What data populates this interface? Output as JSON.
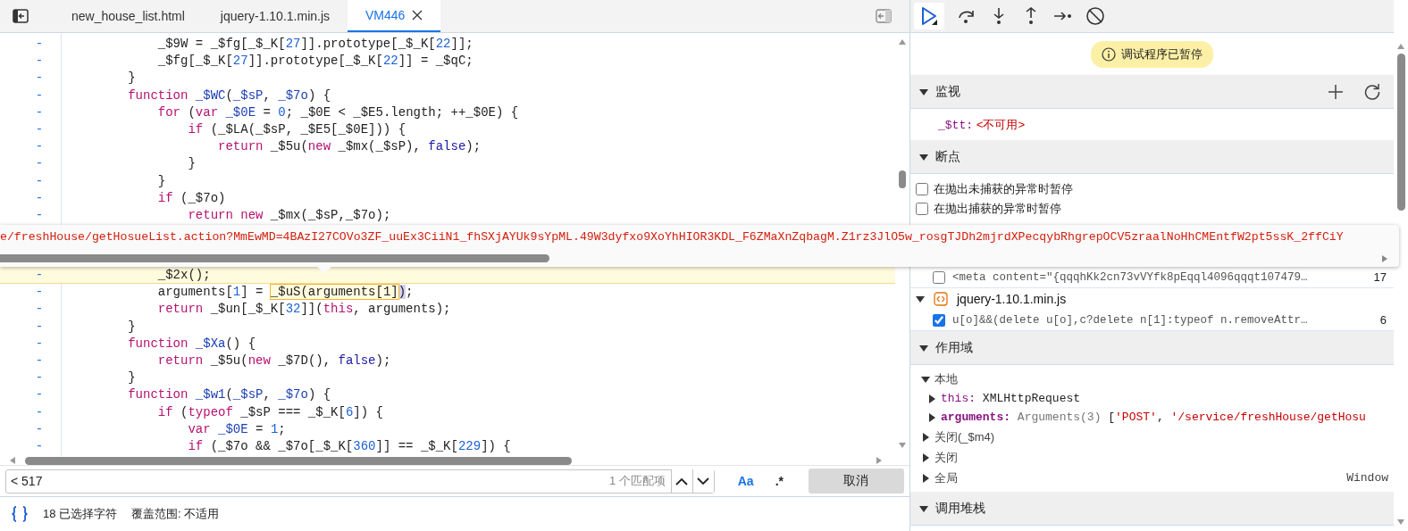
{
  "tabs": [
    {
      "label": "new_house_list.html",
      "selected": false,
      "closable": false
    },
    {
      "label": "jquery-1.10.1.min.js",
      "selected": false,
      "closable": false
    },
    {
      "label": "VM446",
      "selected": true,
      "closable": true
    }
  ],
  "code": {
    "blocks": [
      {
        "lines": [
          {
            "gutter": "-",
            "highlighted": false,
            "tokens": [
              {
                "t": "            _$9W = _$fg[_$_K[",
                "kind": "plain"
              },
              {
                "t": "27",
                "kind": "num"
              },
              {
                "t": "]].prototype[_$_K[",
                "kind": "plain"
              },
              {
                "t": "22",
                "kind": "num"
              },
              {
                "t": "]];",
                "kind": "plain"
              }
            ]
          },
          {
            "gutter": "-",
            "highlighted": false,
            "tokens": [
              {
                "t": "            _$fg[_$_K[",
                "kind": "plain"
              },
              {
                "t": "27",
                "kind": "num"
              },
              {
                "t": "]].prototype[_$_K[",
                "kind": "plain"
              },
              {
                "t": "22",
                "kind": "num"
              },
              {
                "t": "]] = _$qC;",
                "kind": "plain"
              }
            ]
          },
          {
            "gutter": "-",
            "highlighted": false,
            "tokens": [
              {
                "t": "        }",
                "kind": "plain"
              }
            ]
          },
          {
            "gutter": "-",
            "highlighted": false,
            "tokens": [
              {
                "t": "        function",
                "kind": "kw"
              },
              {
                "t": " _$WC",
                "kind": "def"
              },
              {
                "t": "(",
                "kind": "plain"
              },
              {
                "t": "_$sP",
                "kind": "def"
              },
              {
                "t": ", ",
                "kind": "plain"
              },
              {
                "t": "_$7o",
                "kind": "def"
              },
              {
                "t": ") {",
                "kind": "plain"
              }
            ]
          },
          {
            "gutter": "-",
            "highlighted": false,
            "tokens": [
              {
                "t": "            for",
                "kind": "kw"
              },
              {
                "t": " (",
                "kind": "plain"
              },
              {
                "t": "var",
                "kind": "kw"
              },
              {
                "t": " _$0E",
                "kind": "def"
              },
              {
                "t": " = ",
                "kind": "plain"
              },
              {
                "t": "0",
                "kind": "num"
              },
              {
                "t": "; _$0E < _$E5.length; ++_$0E) {",
                "kind": "plain"
              }
            ]
          },
          {
            "gutter": "-",
            "highlighted": false,
            "tokens": [
              {
                "t": "                if",
                "kind": "kw"
              },
              {
                "t": " (_$LA(_$sP, _$E5[_$0E])) {",
                "kind": "plain"
              }
            ]
          },
          {
            "gutter": "-",
            "highlighted": false,
            "tokens": [
              {
                "t": "                    return",
                "kind": "kw"
              },
              {
                "t": " _$5u(",
                "kind": "plain"
              },
              {
                "t": "new",
                "kind": "kw"
              },
              {
                "t": " _$mx(_$sP), ",
                "kind": "plain"
              },
              {
                "t": "false",
                "kind": "atom"
              },
              {
                "t": ");",
                "kind": "plain"
              }
            ]
          },
          {
            "gutter": "-",
            "highlighted": false,
            "tokens": [
              {
                "t": "                }",
                "kind": "plain"
              }
            ]
          },
          {
            "gutter": "-",
            "highlighted": false,
            "tokens": [
              {
                "t": "            }",
                "kind": "plain"
              }
            ]
          },
          {
            "gutter": "-",
            "highlighted": false,
            "tokens": [
              {
                "t": "            if",
                "kind": "kw"
              },
              {
                "t": " (_$7o)",
                "kind": "plain"
              }
            ]
          },
          {
            "gutter": "-",
            "highlighted": false,
            "tokens": [
              {
                "t": "                return",
                "kind": "kw"
              },
              {
                "t": " new",
                "kind": "kw"
              },
              {
                "t": " _$mx(_$sP,_$7o);",
                "kind": "plain"
              }
            ]
          }
        ]
      },
      {
        "lines": [
          {
            "gutter": "-",
            "highlighted": true,
            "tokens": [
              {
                "t": "            _$2x();",
                "kind": "plain"
              }
            ]
          },
          {
            "gutter": "-",
            "highlighted": false,
            "tokens": [
              {
                "t": "            arguments[",
                "kind": "plain"
              },
              {
                "t": "1",
                "kind": "num"
              },
              {
                "t": "] = ",
                "kind": "plain"
              },
              {
                "t": "_$uS(arguments[1]",
                "kind": "match"
              },
              {
                "t": ")",
                "kind": "bracket"
              },
              {
                "t": ";",
                "kind": "plain"
              }
            ]
          },
          {
            "gutter": "-",
            "highlighted": false,
            "tokens": [
              {
                "t": "            return",
                "kind": "kw"
              },
              {
                "t": " _$un[_$_K[",
                "kind": "plain"
              },
              {
                "t": "32",
                "kind": "num"
              },
              {
                "t": "]](",
                "kind": "plain"
              },
              {
                "t": "this",
                "kind": "kw"
              },
              {
                "t": ", arguments);",
                "kind": "plain"
              }
            ]
          },
          {
            "gutter": "-",
            "highlighted": false,
            "tokens": [
              {
                "t": "        }",
                "kind": "plain"
              }
            ]
          },
          {
            "gutter": "-",
            "highlighted": false,
            "tokens": [
              {
                "t": "        function",
                "kind": "kw"
              },
              {
                "t": " _$Xa",
                "kind": "def"
              },
              {
                "t": "() {",
                "kind": "plain"
              }
            ]
          },
          {
            "gutter": "-",
            "highlighted": false,
            "tokens": [
              {
                "t": "            return",
                "kind": "kw"
              },
              {
                "t": " _$5u(",
                "kind": "plain"
              },
              {
                "t": "new",
                "kind": "kw"
              },
              {
                "t": " _$7D(), ",
                "kind": "plain"
              },
              {
                "t": "false",
                "kind": "atom"
              },
              {
                "t": ");",
                "kind": "plain"
              }
            ]
          },
          {
            "gutter": "-",
            "highlighted": false,
            "tokens": [
              {
                "t": "        }",
                "kind": "plain"
              }
            ]
          },
          {
            "gutter": "-",
            "highlighted": false,
            "tokens": [
              {
                "t": "        function",
                "kind": "kw"
              },
              {
                "t": " _$w1",
                "kind": "def"
              },
              {
                "t": "(",
                "kind": "plain"
              },
              {
                "t": "_$sP",
                "kind": "def"
              },
              {
                "t": ", ",
                "kind": "plain"
              },
              {
                "t": "_$7o",
                "kind": "def"
              },
              {
                "t": ") {",
                "kind": "plain"
              }
            ]
          },
          {
            "gutter": "-",
            "highlighted": false,
            "tokens": [
              {
                "t": "            if",
                "kind": "kw"
              },
              {
                "t": " (",
                "kind": "plain"
              },
              {
                "t": "typeof",
                "kind": "kw"
              },
              {
                "t": " _$sP === _$_K[",
                "kind": "plain"
              },
              {
                "t": "6",
                "kind": "num"
              },
              {
                "t": "]) {",
                "kind": "plain"
              }
            ]
          },
          {
            "gutter": "-",
            "highlighted": false,
            "tokens": [
              {
                "t": "                var",
                "kind": "kw"
              },
              {
                "t": " _$0E",
                "kind": "def"
              },
              {
                "t": " = ",
                "kind": "plain"
              },
              {
                "t": "1",
                "kind": "num"
              },
              {
                "t": ";",
                "kind": "plain"
              }
            ]
          },
          {
            "gutter": "-",
            "highlighted": false,
            "tokens": [
              {
                "t": "                if",
                "kind": "kw"
              },
              {
                "t": " (_$7o && _$7o[_$_K[",
                "kind": "plain"
              },
              {
                "t": "360",
                "kind": "num"
              },
              {
                "t": "]] == _$_K[",
                "kind": "plain"
              },
              {
                "t": "229",
                "kind": "num"
              },
              {
                "t": "]) {",
                "kind": "plain"
              }
            ]
          }
        ]
      }
    ]
  },
  "tooltip": {
    "text": "e/freshHouse/getHosueList.action?MmEwMD=4BAzI27COVo3ZF_uuEx3CiiN1_fhSXjAYUk9sYpML.49W3dyfxo9XoYhHIOR3KDL_F6ZMaXnZqbagM.Z1rz3JlO5w_rosgTJDh2mjrdXPecqybRhgrepOCV5zraalNoHhCMEntfW2pt5ssK_2ffCiY"
  },
  "search": {
    "value": "< 517",
    "match_count": "1 个匹配项",
    "case_toggle": "Aa",
    "regex_toggle": ".*",
    "cancel": "取消"
  },
  "status_bar": {
    "selection": "18 已选择字符",
    "coverage": "覆盖范围: 不适用"
  },
  "paused_badge": "调试程序已暂停",
  "sections": [
    {
      "kind": "watch",
      "title": "监视",
      "expanded": true,
      "items": [
        {
          "name": "_$tt:",
          "value": "<不可用>"
        }
      ]
    },
    {
      "kind": "breakpoints",
      "title": "断点",
      "expanded": true,
      "options": [
        {
          "label": "在抛出未捕获的异常时暂停",
          "checked": false
        },
        {
          "label": "在抛出捕获的异常时暂停",
          "checked": false
        }
      ],
      "files": [
        {
          "breakpoints": [
            {
              "code": "<meta content=\"{qqqhKk2cn73vVYfk8pEqql4096qqqt107479…",
              "line": "17",
              "checked": false
            }
          ]
        },
        {
          "name": "jquery-1.10.1.min.js",
          "expanded": true,
          "breakpoints": [
            {
              "code": "u[o]&&(delete u[o],c?delete n[1]:typeof n.removeAttr…",
              "line": "6",
              "checked": true
            }
          ]
        }
      ]
    },
    {
      "kind": "scope",
      "title": "作用域",
      "expanded": true,
      "groups": [
        {
          "name": "本地",
          "expanded": true,
          "children": [
            {
              "name": "this:",
              "bold": false,
              "expanded": false,
              "value": [
                {
                  "t": "XMLHttpRequest",
                  "kind": "plain"
                }
              ]
            },
            {
              "name": "arguments:",
              "bold": true,
              "expanded": false,
              "value": [
                {
                  "t": "Arguments(3)",
                  "kind": "type"
                },
                {
                  "t": " [",
                  "kind": "plain"
                },
                {
                  "t": "'POST'",
                  "kind": "str"
                },
                {
                  "t": ", ",
                  "kind": "plain"
                },
                {
                  "t": "'/service/freshHouse/getHosu",
                  "kind": "str"
                }
              ]
            }
          ]
        },
        {
          "name": "关闭(_$m4)",
          "expanded": false
        },
        {
          "name": "关闭",
          "expanded": false
        },
        {
          "name": "全局",
          "expanded": false,
          "value": "Window"
        }
      ]
    },
    {
      "kind": "callstack",
      "title": "调用堆栈",
      "expanded": true
    }
  ]
}
